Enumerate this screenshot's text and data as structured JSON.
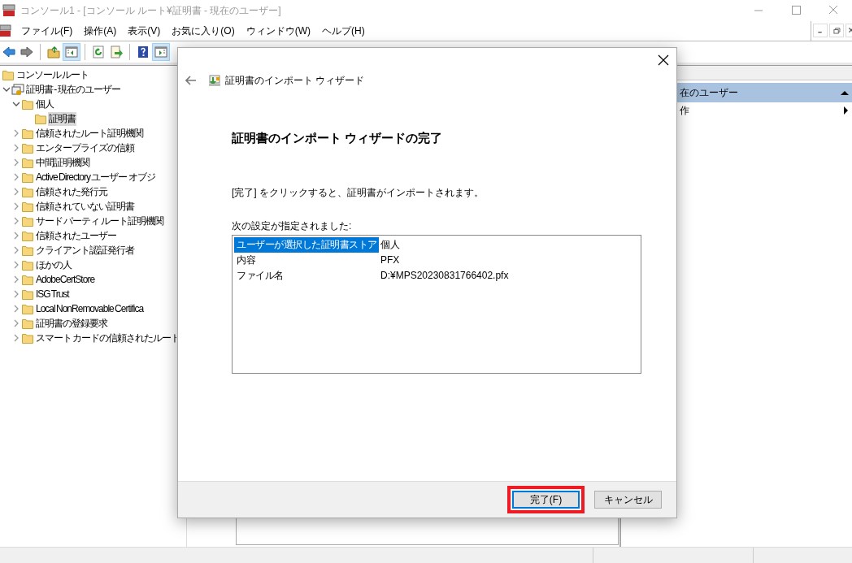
{
  "window": {
    "title": "コンソール1 - [コンソール ルート¥証明書 - 現在のユーザー]"
  },
  "menu": [
    "ファイル(F)",
    "操作(A)",
    "表示(V)",
    "お気に入り(O)",
    "ウィンドウ(W)",
    "ヘルプ(H)"
  ],
  "toolbar": [
    {
      "kind": "back",
      "pressed": false
    },
    {
      "kind": "forward",
      "pressed": false
    },
    {
      "kind": "separator"
    },
    {
      "kind": "up",
      "pressed": false
    },
    {
      "kind": "tree",
      "pressed": true
    },
    {
      "kind": "separator"
    },
    {
      "kind": "refresh",
      "pressed": false
    },
    {
      "kind": "export",
      "pressed": false
    },
    {
      "kind": "separator"
    },
    {
      "kind": "help",
      "pressed": false
    },
    {
      "kind": "actions",
      "pressed": true
    }
  ],
  "tree": [
    {
      "label": "コンソール ルート",
      "kind": "folder",
      "selected": false
    },
    {
      "label": "証明書 - 現在のユーザー",
      "kind": "store",
      "selected": false,
      "expanded": true,
      "children": [
        {
          "label": "個人",
          "kind": "folder",
          "selected": false,
          "expanded": true,
          "children": [
            {
              "label": "証明書",
              "kind": "folder",
              "selected": true
            }
          ]
        },
        {
          "label": "信頼されたルート証明機関",
          "kind": "folder",
          "selected": false,
          "expanded": false
        },
        {
          "label": "エンタープライズの信頼",
          "kind": "folder",
          "selected": false,
          "expanded": false
        },
        {
          "label": "中間証明機関",
          "kind": "folder",
          "selected": false,
          "expanded": false
        },
        {
          "label": "Active Directory ユーザー オブジ",
          "kind": "folder",
          "selected": false,
          "expanded": false
        },
        {
          "label": "信頼された発行元",
          "kind": "folder",
          "selected": false,
          "expanded": false
        },
        {
          "label": "信頼されていない証明書",
          "kind": "folder",
          "selected": false,
          "expanded": false
        },
        {
          "label": "サード パーティ ルート証明機関",
          "kind": "folder",
          "selected": false,
          "expanded": false
        },
        {
          "label": "信頼されたユーザー",
          "kind": "folder",
          "selected": false,
          "expanded": false
        },
        {
          "label": "クライアント認証発行者",
          "kind": "folder",
          "selected": false,
          "expanded": false
        },
        {
          "label": "ほかの人",
          "kind": "folder",
          "selected": false,
          "expanded": false
        },
        {
          "label": "AdobeCertStore",
          "kind": "folder",
          "selected": false,
          "expanded": false
        },
        {
          "label": "ISG Trust",
          "kind": "folder",
          "selected": false,
          "expanded": false
        },
        {
          "label": "Local NonRemovable Certifica",
          "kind": "folder",
          "selected": false,
          "expanded": false
        },
        {
          "label": "証明書の登録要求",
          "kind": "folder",
          "selected": false,
          "expanded": false
        },
        {
          "label": "スマート カードの信頼されたルート",
          "kind": "folder",
          "selected": false,
          "expanded": false
        }
      ]
    }
  ],
  "actions_pane": {
    "header": "在のユーザー",
    "items": [
      "作"
    ]
  },
  "dialog": {
    "title": "証明書のインポート ウィザード",
    "heading": "証明書のインポート ウィザードの完了",
    "message": "[完了] をクリックすると、証明書がインポートされます。",
    "settings_label": "次の設定が指定されました:",
    "settings": [
      {
        "name": "ユーザーが選択した証明書ストア",
        "value": "個人",
        "selected": true
      },
      {
        "name": "内容",
        "value": "PFX",
        "selected": false
      },
      {
        "name": "ファイル名",
        "value": "D:¥MPS20230831766402.pfx",
        "selected": false
      }
    ],
    "buttons": [
      {
        "label": "完了(F)",
        "default": true,
        "highlighted": true
      },
      {
        "label": "キャンセル",
        "default": false,
        "highlighted": false
      }
    ]
  }
}
